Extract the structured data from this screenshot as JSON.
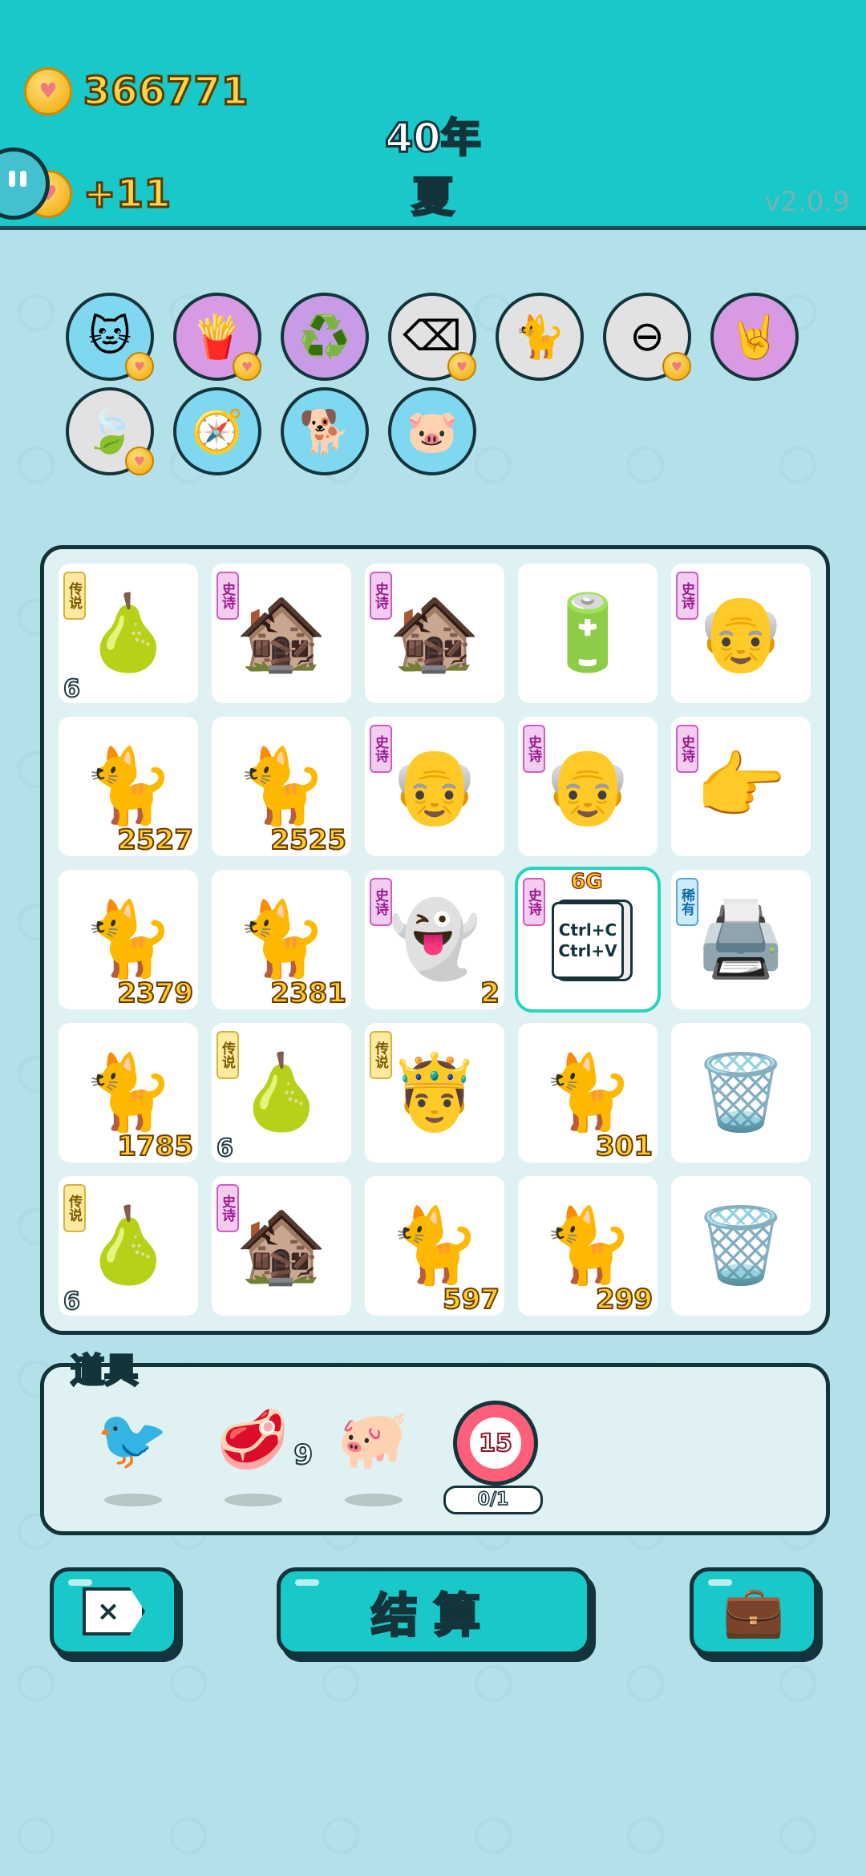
{
  "header": {
    "coins": "366771",
    "income": "+11",
    "year": "40年",
    "season": "夏",
    "version": "v2.0.9"
  },
  "perks": [
    {
      "name": "cat-perk",
      "glyph": "🐱",
      "bg": "#7fd8f0",
      "heart": true
    },
    {
      "name": "fries-perk",
      "glyph": "🍟",
      "bg": "#d89be3",
      "heart": true
    },
    {
      "name": "recycle-perk",
      "glyph": "♻️",
      "bg": "#c89be6",
      "heart": false
    },
    {
      "name": "delete-tag-perk",
      "glyph": "⌫",
      "bg": "#e2e2e2",
      "heart": true
    },
    {
      "name": "cat-pair-perk",
      "glyph": "🐈",
      "bg": "#e2e2e2",
      "heart": false
    },
    {
      "name": "minus-perk",
      "glyph": "⊖",
      "bg": "#e2e2e2",
      "heart": true
    },
    {
      "name": "rock-hand-perk",
      "glyph": "🤘",
      "bg": "#d89be3",
      "heart": false
    },
    {
      "name": "leaf-perk",
      "glyph": "🍃",
      "bg": "#e2e2e2",
      "heart": true
    },
    {
      "name": "compass-perk",
      "glyph": "🧭",
      "bg": "#7fd8f0",
      "heart": false
    },
    {
      "name": "dog-perk",
      "glyph": "🐕",
      "bg": "#7fd8f0",
      "heart": false
    },
    {
      "name": "piggy-perk",
      "glyph": "🐷",
      "bg": "#7fd8f0",
      "heart": false
    }
  ],
  "board": [
    {
      "item": "pear",
      "glyph": "🍐",
      "tag": "传说",
      "tagType": "legend",
      "num": "",
      "numLeft": "6"
    },
    {
      "item": "haunted-house",
      "glyph": "🏚️",
      "tag": "史诗",
      "tagType": "epic",
      "num": "",
      "numLeft": ""
    },
    {
      "item": "haunted-house",
      "glyph": "🏚️",
      "tag": "史诗",
      "tagType": "epic",
      "num": "",
      "numLeft": ""
    },
    {
      "item": "battery",
      "glyph": "🔋",
      "tag": "",
      "tagType": "",
      "num": "",
      "numLeft": ""
    },
    {
      "item": "grumpy-man",
      "glyph": "👴",
      "tag": "史诗",
      "tagType": "epic",
      "num": "",
      "numLeft": ""
    },
    {
      "item": "cat",
      "glyph": "🐈",
      "tag": "",
      "tagType": "",
      "num": "2527",
      "numLeft": ""
    },
    {
      "item": "cat",
      "glyph": "🐈",
      "tag": "",
      "tagType": "",
      "num": "2525",
      "numLeft": ""
    },
    {
      "item": "grumpy-man",
      "glyph": "👴",
      "tag": "史诗",
      "tagType": "epic",
      "num": "",
      "numLeft": ""
    },
    {
      "item": "grumpy-man",
      "glyph": "👴",
      "tag": "史诗",
      "tagType": "epic",
      "num": "",
      "numLeft": ""
    },
    {
      "item": "pointing-hand",
      "glyph": "👉",
      "tag": "史诗",
      "tagType": "epic",
      "num": "",
      "numLeft": ""
    },
    {
      "item": "cat",
      "glyph": "🐈",
      "tag": "",
      "tagType": "",
      "num": "2379",
      "numLeft": ""
    },
    {
      "item": "cat",
      "glyph": "🐈",
      "tag": "",
      "tagType": "",
      "num": "2381",
      "numLeft": ""
    },
    {
      "item": "ghost",
      "glyph": "👻",
      "tag": "史诗",
      "tagType": "epic",
      "num": "2",
      "numLeft": ""
    },
    {
      "item": "ctrl-c-ctrl-v",
      "glyph": "📋",
      "tag": "史诗",
      "tagType": "epic",
      "num": "",
      "numLeft": "",
      "selected": true,
      "label": "Ctrl+C\nCtrl+V",
      "badge": "6G"
    },
    {
      "item": "printer",
      "glyph": "🖨️",
      "tag": "稀有",
      "tagType": "rare",
      "num": "",
      "numLeft": ""
    },
    {
      "item": "cat",
      "glyph": "🐈",
      "tag": "",
      "tagType": "",
      "num": "1785",
      "numLeft": ""
    },
    {
      "item": "pear",
      "glyph": "🍐",
      "tag": "传说",
      "tagType": "legend",
      "num": "",
      "numLeft": "6"
    },
    {
      "item": "king",
      "glyph": "🤴",
      "tag": "传说",
      "tagType": "legend",
      "num": "",
      "numLeft": ""
    },
    {
      "item": "cat",
      "glyph": "🐈",
      "tag": "",
      "tagType": "",
      "num": "301",
      "numLeft": ""
    },
    {
      "item": "trash-bag",
      "glyph": "🗑️",
      "tag": "",
      "tagType": "",
      "num": "",
      "numLeft": ""
    },
    {
      "item": "pear",
      "glyph": "🍐",
      "tag": "传说",
      "tagType": "legend",
      "num": "",
      "numLeft": "6"
    },
    {
      "item": "haunted-house",
      "glyph": "🏚️",
      "tag": "史诗",
      "tagType": "epic",
      "num": "",
      "numLeft": ""
    },
    {
      "item": "cat",
      "glyph": "🐈",
      "tag": "",
      "tagType": "",
      "num": "597",
      "numLeft": ""
    },
    {
      "item": "cat",
      "glyph": "🐈",
      "tag": "",
      "tagType": "",
      "num": "299",
      "numLeft": ""
    },
    {
      "item": "trash-bag",
      "glyph": "🗑️",
      "tag": "",
      "tagType": "",
      "num": "",
      "numLeft": ""
    }
  ],
  "items": {
    "label": "道具",
    "list": [
      {
        "name": "bird-item",
        "glyph": "🐦",
        "count": ""
      },
      {
        "name": "liver-item",
        "glyph": "🥩",
        "count": "9"
      },
      {
        "name": "piggy-bank-item",
        "glyph": "🐖",
        "count": ""
      }
    ],
    "timer": "15",
    "timer_progress": "0/1"
  },
  "actions": {
    "settle_label": "结算",
    "remove_label": "×"
  }
}
